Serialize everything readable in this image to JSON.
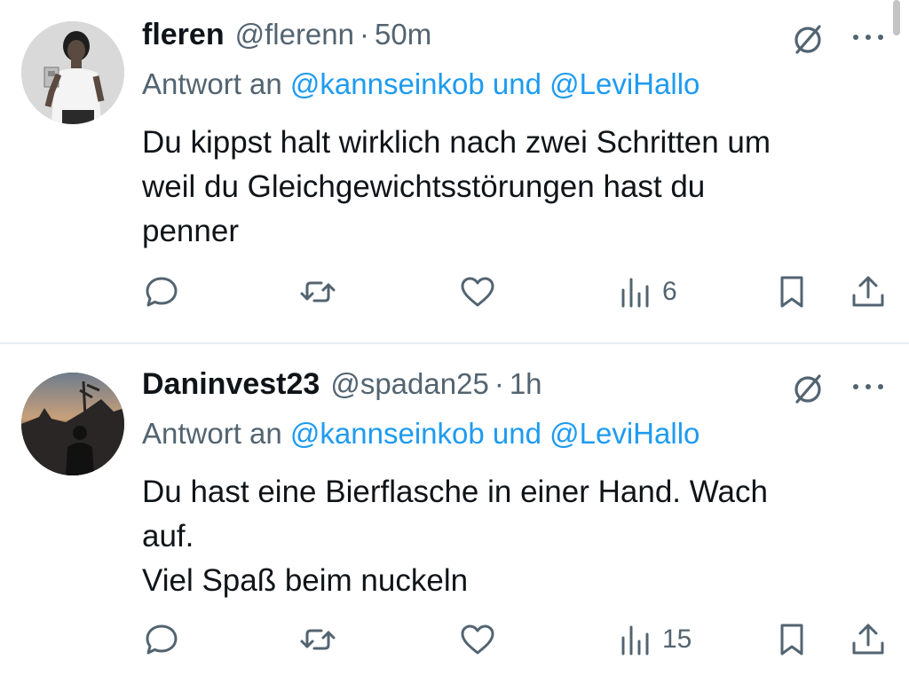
{
  "colors": {
    "text": "#0f1419",
    "secondary": "#536471",
    "link": "#1d9bf0",
    "divider": "#e6ecf0"
  },
  "icons": {
    "reply": "reply-icon",
    "retweet": "retweet-icon",
    "like": "heart-icon",
    "views": "views-bar-icon",
    "bookmark": "bookmark-icon",
    "share": "share-icon",
    "grok": "grok-icon",
    "more": "more-icon"
  },
  "tweets": [
    {
      "display_name": "fleren",
      "handle": "@flerenn",
      "separator": "·",
      "time": "50m",
      "reply_prefix": "Antwort an",
      "mention_1": "@kannseinkob",
      "reply_joiner": "und",
      "mention_2": "@LeviHallo",
      "lines": [
        "Du kippst halt wirklich nach zwei Schritten um",
        "weil du Gleichgewichtsstörungen hast du",
        "penner"
      ],
      "views": "6"
    },
    {
      "display_name": "Daninvest23",
      "handle": "@spadan25",
      "separator": "·",
      "time": "1h",
      "reply_prefix": "Antwort an",
      "mention_1": "@kannseinkob",
      "reply_joiner": "und",
      "mention_2": "@LeviHallo",
      "lines": [
        "Du hast eine Bierflasche in einer Hand. Wach",
        "auf.",
        "Viel Spaß beim nuckeln"
      ],
      "views": "15"
    }
  ]
}
